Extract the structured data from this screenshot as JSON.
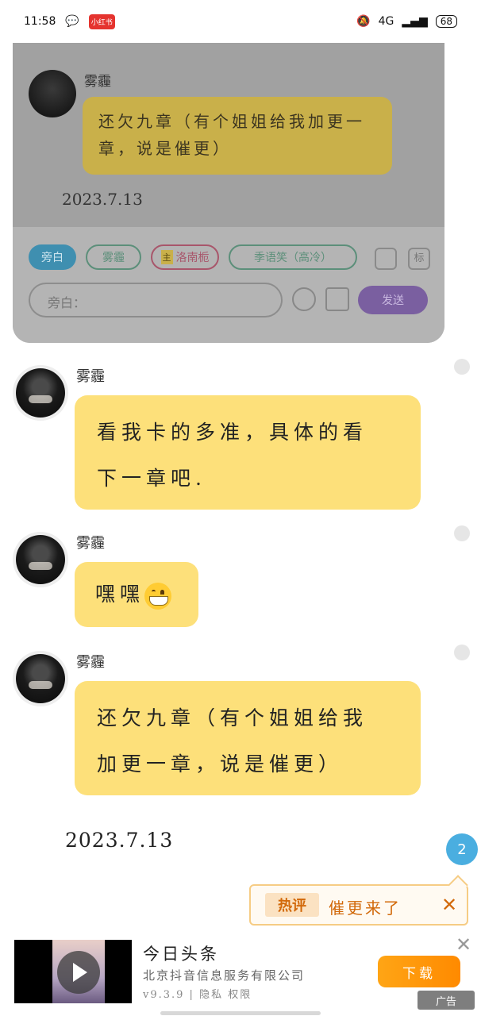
{
  "status": {
    "time": "11:58",
    "app_badge": "小红书",
    "signal": "4G",
    "battery": "68"
  },
  "overlay": {
    "name": "雾霾",
    "message": "还欠九章（有个姐姐给我加更一章，说是催更）",
    "date": "2023.7.13",
    "chips": [
      "旁白",
      "雾霾",
      "洛南栀",
      "季语笑（高冷）"
    ],
    "chip_tag": "主",
    "input_placeholder": "旁白：",
    "send_label": "发送",
    "tag_btn": "标"
  },
  "messages": [
    {
      "name": "雾霾",
      "text_line1": "看我卡的多准，具体的看",
      "text_line2": "下一章吧."
    },
    {
      "name": "雾霾",
      "text": "嘿嘿"
    },
    {
      "name": "雾霾",
      "text_line1": "还欠九章（有个姐姐给我",
      "text_line2": "加更一章，说是催更）"
    }
  ],
  "date": "2023.7.13",
  "badge_count": "2",
  "hot_comment": {
    "tag": "热评",
    "text": "催更来了",
    "close": "✕"
  },
  "ad": {
    "title": "今日头条",
    "company": "北京抖音信息服务有限公司",
    "meta": "v9.3.9 | 隐私  权限",
    "button": "下载",
    "close": "✕",
    "label": "广告"
  }
}
